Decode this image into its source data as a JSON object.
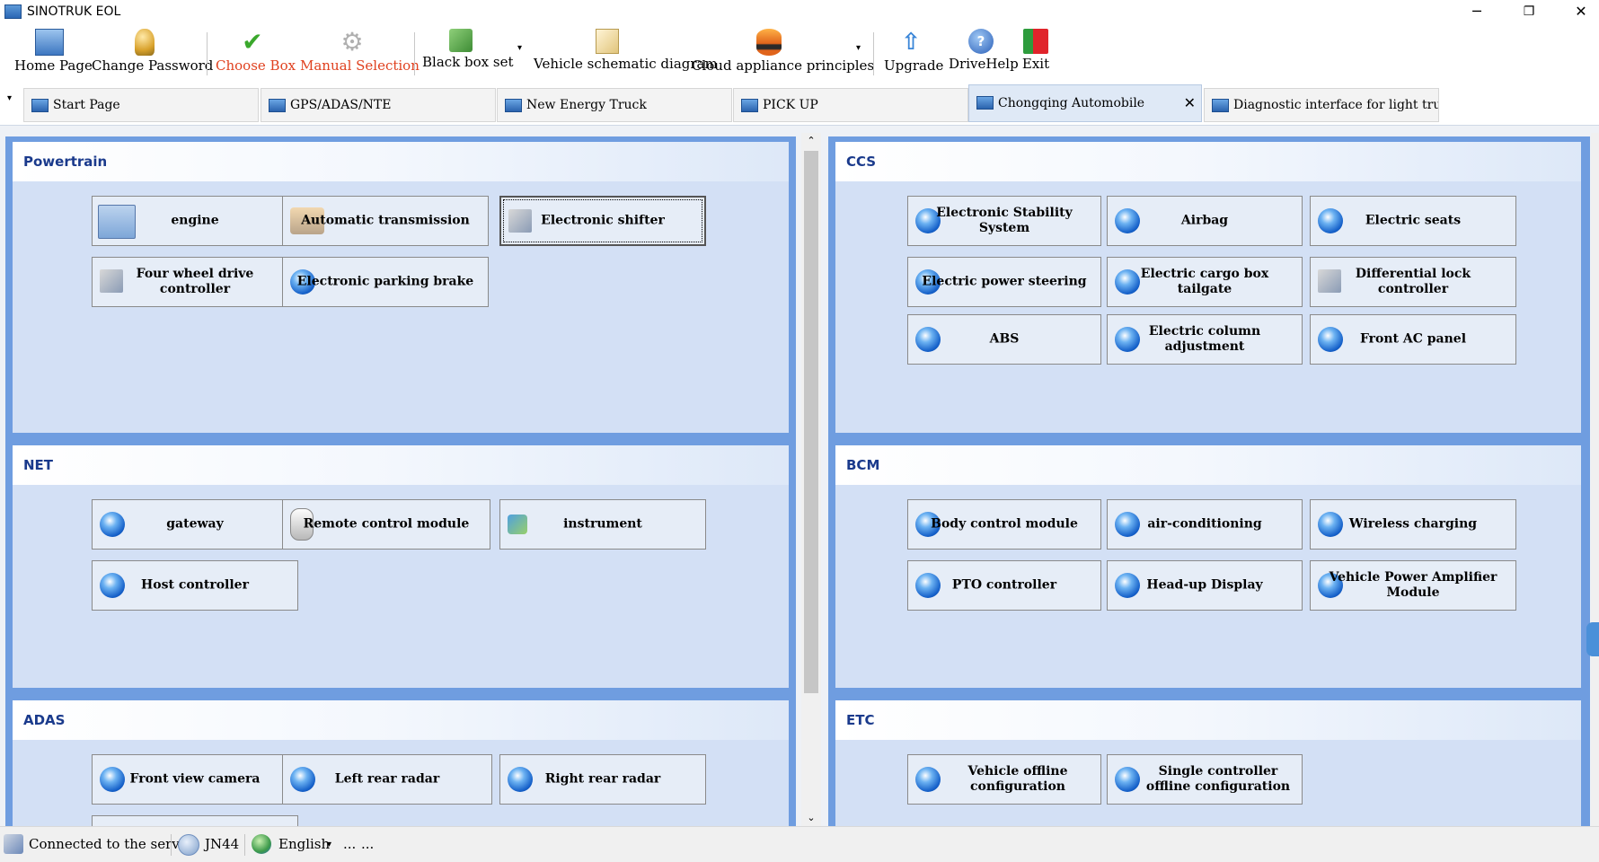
{
  "window": {
    "title": "SINOTRUK EOL",
    "minimize": "─",
    "restore": "❐",
    "close": "✕"
  },
  "toolbar": {
    "home": "Home Page",
    "change_password": "Change Password",
    "choose_box": "Choose Box",
    "manual_selection": "Manual Selection",
    "black_box_set": "Black box set",
    "vehicle_schematic": "Vehicle schematic diagram",
    "cloud_appliance": "Cloud appliance principles",
    "upgrade": "Upgrade",
    "drive_help": "DriveHelp",
    "exit": "Exit",
    "dropdown": "▾",
    "accent_red": "#e0411f"
  },
  "tabs": [
    {
      "label": "Start Page"
    },
    {
      "label": "GPS/ADAS/NTE"
    },
    {
      "label": "New Energy Truck"
    },
    {
      "label": "PICK UP"
    },
    {
      "label": "Chongqing Automobile",
      "active": true,
      "close": "✕"
    },
    {
      "label": "Diagnostic interface for light trucks"
    }
  ],
  "tab_menu": "▾",
  "sections": {
    "powertrain": {
      "title": "Powertrain",
      "items": [
        "engine",
        "Automatic transmission",
        "Electronic shifter",
        "Four wheel drive controller",
        "Electronic parking brake"
      ]
    },
    "net": {
      "title": "NET",
      "items": [
        "gateway",
        "Remote control module",
        "instrument",
        "Host controller"
      ]
    },
    "adas": {
      "title": "ADAS",
      "items": [
        "Front view camera",
        "Left rear radar",
        "Right rear radar"
      ]
    },
    "ccs": {
      "title": "CCS",
      "items": [
        "Electronic Stability System",
        "Airbag",
        "Electric seats",
        "Electric power steering",
        "Electric cargo box tailgate",
        "Differential lock controller",
        "ABS",
        "Electric column adjustment",
        "Front AC panel"
      ]
    },
    "bcm": {
      "title": "BCM",
      "items": [
        "Body control module",
        "air-conditioning",
        "Wireless charging",
        "PTO controller",
        "Head-up Display",
        "Vehicle Power Amplifier Module"
      ]
    },
    "etc": {
      "title": "ETC",
      "items": [
        "Vehicle offline configuration",
        "Single controller offline configuration"
      ]
    }
  },
  "scroll": {
    "up": "⌃",
    "down": "⌄"
  },
  "status": {
    "connection": "Connected to the server",
    "device": "JN44",
    "language": "English",
    "lang_drop": "▾",
    "extra1": "...",
    "extra2": "..."
  }
}
